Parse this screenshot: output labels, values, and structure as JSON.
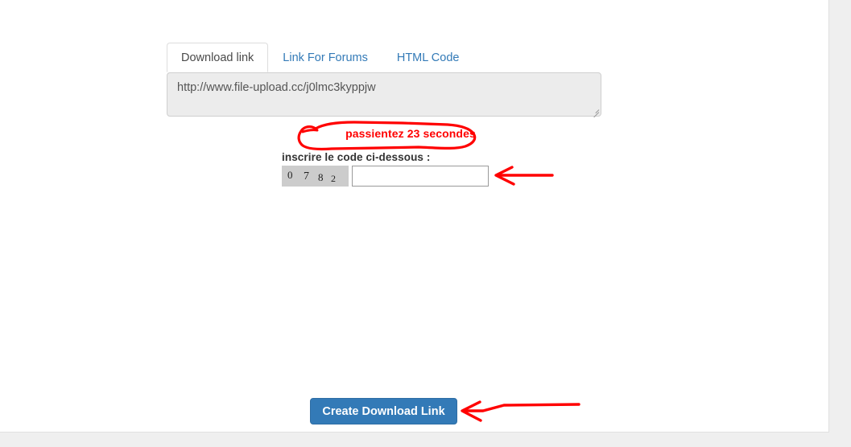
{
  "page": {
    "background_color": "#efefef",
    "panel_color": "#ffffff"
  },
  "tabs": [
    {
      "label": "Download link",
      "active": true
    },
    {
      "label": "Link For Forums",
      "active": false
    },
    {
      "label": "HTML Code",
      "active": false
    }
  ],
  "download_link": {
    "value": "http://www.file-upload.cc/j0lmc3kyppjw",
    "placeholder": "",
    "resize_grip": "resize-grip-icon"
  },
  "wait_notice": {
    "text": "passientez 23 secondes",
    "color": "#ff0000",
    "seconds": 23
  },
  "captcha": {
    "label": "inscrire le code ci-dessous :",
    "code_digits": [
      "0",
      "7",
      "8",
      "2"
    ],
    "code": "0782",
    "input_value": "",
    "input_placeholder": ""
  },
  "submit": {
    "label": "Create Download Link",
    "color": "#337ab7"
  },
  "annotations": {
    "circle_around_notice": "red-ellipse-annotation",
    "arrow_to_captcha_input": "red-arrow-annotation",
    "arrow_to_create_button": "red-arrow-annotation",
    "color": "#ff0000"
  }
}
